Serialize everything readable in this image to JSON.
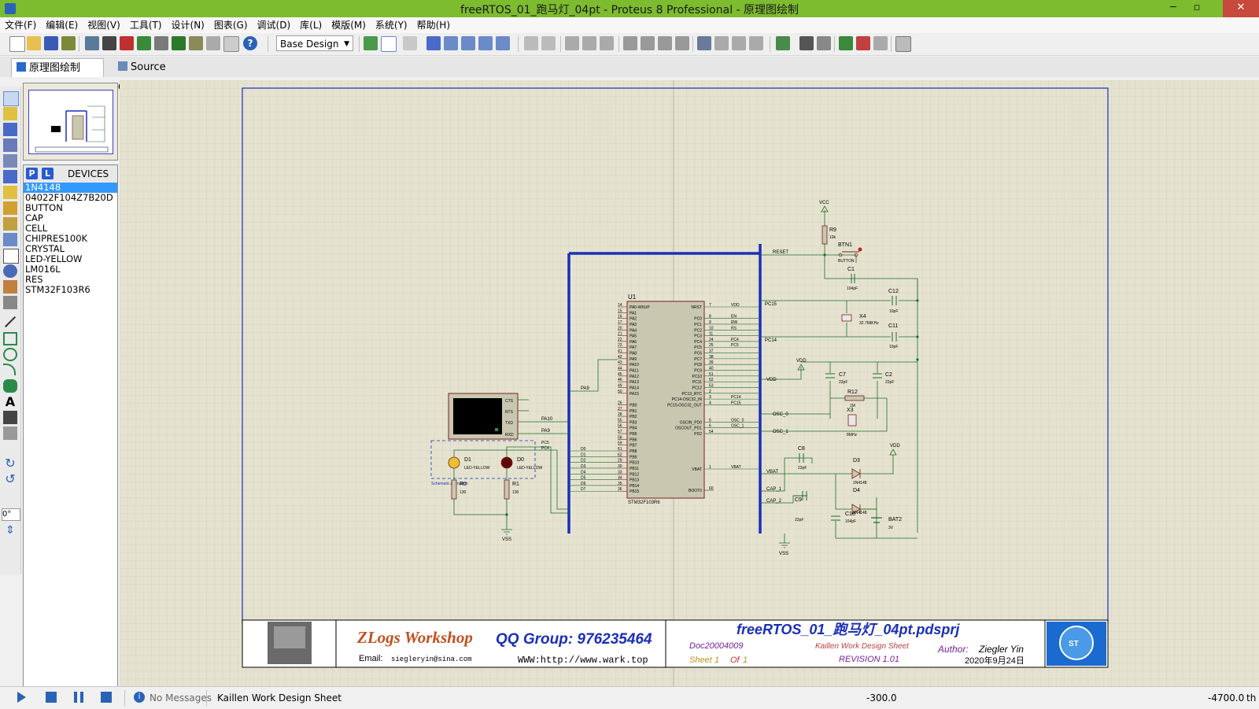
{
  "window": {
    "title": "freeRTOS_01_跑马灯_04pt - Proteus 8 Professional - 原理图绘制",
    "minimize": "─",
    "maximize": "▫",
    "close": "✕"
  },
  "menu": [
    "文件(F)",
    "编辑(E)",
    "视图(V)",
    "工具(T)",
    "设计(N)",
    "图表(G)",
    "调试(D)",
    "库(L)",
    "模版(M)",
    "系统(Y)",
    "帮助(H)"
  ],
  "toolbar": {
    "design_select": "Base Design"
  },
  "tabs": [
    {
      "label": "原理图绘制",
      "active": true
    },
    {
      "label": "Source Code",
      "active": false
    }
  ],
  "left_tools": {
    "rotation": "0°"
  },
  "devices": {
    "p_label": "P",
    "l_label": "L",
    "title": "DEVICES",
    "items": [
      "1N4148",
      "04022F104Z7B20D",
      "BUTTON",
      "CAP",
      "CELL",
      "CHIPRES100K",
      "CRYSTAL",
      "LED-YELLOW",
      "LM016L",
      "RES",
      "STM32F103R6"
    ],
    "selected_index": 0
  },
  "schematic": {
    "mcu": {
      "ref": "U1",
      "part": "STM32F103R6"
    },
    "components": {
      "r9": "R9",
      "r9_val": "10k",
      "btn1": "BTN1",
      "btn1_val": "BUTTON",
      "c1": "C1",
      "c1_val": "104pF",
      "c12": "C12",
      "c12_val": "10pF",
      "x4": "X4",
      "x4_val": "32.768KHz",
      "c11": "C11",
      "c11_val": "10pF",
      "c7": "C7",
      "c7_val": "22pF",
      "c2": "C2",
      "c2_val": "22pF",
      "r12": "R12",
      "r12_val": "1M",
      "x3": "X3",
      "x3_val": "8MHz",
      "c8": "C8",
      "c8_val": "22pF",
      "d3": "D3",
      "d3_val": "1N4148",
      "d4": "D4",
      "d4_val": "1N4148",
      "c9": "C9",
      "c9_val": "22pF",
      "c10": "C10",
      "c10_val": "104pF",
      "bat2": "BAT2",
      "bat2_val": "3V",
      "d1": "D1",
      "d1_val": "LED-YELLOW",
      "d0": "D0",
      "d0_val": "LED-YELLOW",
      "r0": "R0",
      "r0_val": "130",
      "r1": "R1",
      "r1_val": "130",
      "sim_label": "Schematic Animation"
    },
    "power": {
      "vcc": "VCC",
      "vdd": "VDD",
      "vss": "VSS"
    },
    "nets": {
      "reset": "RESET",
      "pc15": "PC15",
      "pc14": "PC14",
      "vdd": "VDD",
      "pa9": "PA9",
      "pa10": "PA10",
      "en": "EN",
      "rw": "RW",
      "rs": "RS",
      "pc4": "PC4",
      "pc5": "PC5",
      "osc0": "OSC_0",
      "osc1": "OSC_1",
      "vbat": "VBAT",
      "cap1": "CAP_1",
      "cap2": "CAP_2",
      "d0": "D0",
      "d1": "D1",
      "d2": "D2",
      "d3": "D3",
      "d4": "D4",
      "d5": "D5",
      "d6": "D6",
      "d7": "D7",
      "cts": "CTS",
      "rts": "RTS",
      "txd": "TXD",
      "rxd": "RXD"
    },
    "left_pins": [
      {
        "n": "14",
        "name": "PA0-WKUP"
      },
      {
        "n": "15",
        "name": "PA1"
      },
      {
        "n": "16",
        "name": "PA2"
      },
      {
        "n": "17",
        "name": "PA3"
      },
      {
        "n": "20",
        "name": "PA4"
      },
      {
        "n": "21",
        "name": "PA5"
      },
      {
        "n": "22",
        "name": "PA6"
      },
      {
        "n": "23",
        "name": "PA7"
      },
      {
        "n": "41",
        "name": "PA8"
      },
      {
        "n": "42",
        "name": "PA9"
      },
      {
        "n": "43",
        "name": "PA10"
      },
      {
        "n": "44",
        "name": "PA11"
      },
      {
        "n": "45",
        "name": "PA12"
      },
      {
        "n": "46",
        "name": "PA13"
      },
      {
        "n": "49",
        "name": "PA14"
      },
      {
        "n": "50",
        "name": "PA15"
      },
      {
        "n": "",
        "name": ""
      },
      {
        "n": "26",
        "name": "PB0"
      },
      {
        "n": "27",
        "name": "PB1"
      },
      {
        "n": "28",
        "name": "PB2"
      },
      {
        "n": "55",
        "name": "PB3"
      },
      {
        "n": "56",
        "name": "PB4"
      },
      {
        "n": "57",
        "name": "PB5"
      },
      {
        "n": "58",
        "name": "PB6"
      },
      {
        "n": "59",
        "name": "PB7"
      },
      {
        "n": "61",
        "name": "PB8"
      },
      {
        "n": "62",
        "name": "PB9"
      },
      {
        "n": "29",
        "name": "PB10"
      },
      {
        "n": "30",
        "name": "PB11"
      },
      {
        "n": "33",
        "name": "PB12"
      },
      {
        "n": "34",
        "name": "PB13"
      },
      {
        "n": "35",
        "name": "PB14"
      },
      {
        "n": "36",
        "name": "PB15"
      }
    ],
    "right_pins": [
      {
        "n": "7",
        "name": "NRST",
        "net": "VDD"
      },
      {
        "n": "",
        "name": "",
        "net": ""
      },
      {
        "n": "8",
        "name": "PC0",
        "net": "EN"
      },
      {
        "n": "9",
        "name": "PC1",
        "net": "RW"
      },
      {
        "n": "10",
        "name": "PC2",
        "net": "RS"
      },
      {
        "n": "11",
        "name": "PC3",
        "net": ""
      },
      {
        "n": "24",
        "name": "PC4",
        "net": "PC4"
      },
      {
        "n": "25",
        "name": "PC5",
        "net": "PC5"
      },
      {
        "n": "37",
        "name": "PC6",
        "net": ""
      },
      {
        "n": "38",
        "name": "PC7",
        "net": ""
      },
      {
        "n": "39",
        "name": "PC8",
        "net": ""
      },
      {
        "n": "40",
        "name": "PC9",
        "net": ""
      },
      {
        "n": "51",
        "name": "PC10",
        "net": ""
      },
      {
        "n": "52",
        "name": "PC11",
        "net": ""
      },
      {
        "n": "53",
        "name": "PC12",
        "net": ""
      },
      {
        "n": "2",
        "name": "PC13_RTC",
        "net": ""
      },
      {
        "n": "3",
        "name": "PC14-OSC32_IN",
        "net": "PC14"
      },
      {
        "n": "4",
        "name": "PC15-OSC32_OUT",
        "net": "PC15"
      },
      {
        "n": "",
        "name": "",
        "net": ""
      },
      {
        "n": "",
        "name": "",
        "net": ""
      },
      {
        "n": "5",
        "name": "OSCIN_PD0",
        "net": "OSC_0"
      },
      {
        "n": "6",
        "name": "OSCOUT_PD1",
        "net": "OSC_1"
      },
      {
        "n": "54",
        "name": "PD2",
        "net": ""
      }
    ],
    "vbat_pin": {
      "n": "1",
      "name": "VBAT",
      "net": "VBAT"
    },
    "boot_pin": {
      "n": "60",
      "name": "BOOT0"
    }
  },
  "title_block": {
    "brand": "ZLogs Workshop",
    "qq": "QQ Group: 976235464",
    "email_label": "Email:",
    "email": "siegleryin@sina.com",
    "www": "WWW:http://www.wark.top",
    "project": "freeRTOS_01_跑马灯_04pt.pdsprj",
    "doc": "Doc20004009",
    "design_sheet": "Kaillen Work Design Sheet",
    "author_label": "Author:",
    "author": "Ziegler Yin",
    "sheet_label": "Sheet",
    "sheet_num": "1",
    "of_label": "Of",
    "of_num": "1",
    "revision": "REVISION 1.01",
    "date": "2020年9月24日",
    "logo_text": "ST"
  },
  "status": {
    "messages": "No Messages",
    "sheet": "Kaillen Work Design Sheet",
    "coord_x": "-300.0",
    "coord_y": "-4700.0",
    "unit": "th"
  },
  "colors": {
    "titlebar": "#7dbb2f",
    "bus": "#1a2fb8",
    "wire": "#1e6b2a",
    "chip": "#c8c8b0",
    "chip_border": "#7a1f1f",
    "canvas": "#e5e3d0"
  }
}
